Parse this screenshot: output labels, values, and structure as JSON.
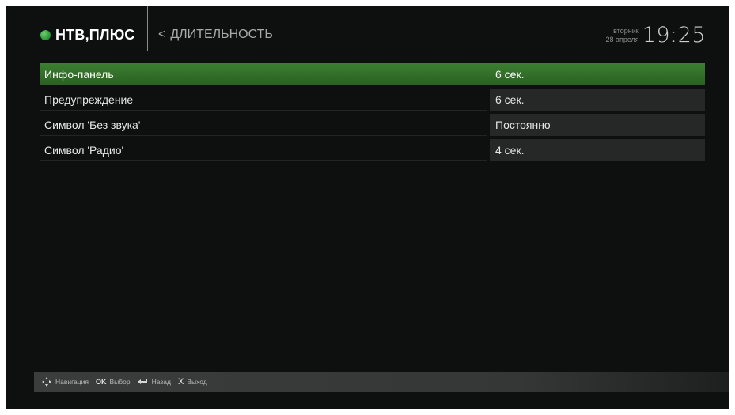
{
  "header": {
    "logo_text": "НТВ,ПЛЮС",
    "breadcrumb_arrow": "<",
    "breadcrumb_title": "ДЛИТЕЛЬНОСТЬ",
    "weekday": "вторник",
    "date": "28 апреля",
    "time": "19:25"
  },
  "settings": {
    "items": [
      {
        "label": "Инфо-панель",
        "value": "6 сек.",
        "selected": true
      },
      {
        "label": "Предупреждение",
        "value": "6 сек.",
        "selected": false
      },
      {
        "label": "Символ 'Без звука'",
        "value": "Постоянно",
        "selected": false
      },
      {
        "label": "Символ 'Радио'",
        "value": "4 сек.",
        "selected": false
      }
    ]
  },
  "hints": {
    "navigation_label": "Навигация",
    "ok_key": "OK",
    "select_label": "Выбор",
    "back_label": "Назад",
    "exit_key": "X",
    "exit_label": "Выход"
  },
  "colors": {
    "accent_green": "#2f6b27",
    "background": "#0e0f0f",
    "value_cell": "#262828"
  },
  "icons": {
    "logo": "green-dot-logo-icon",
    "navigation": "dpad-arrows-icon",
    "back": "return-arrow-icon"
  }
}
